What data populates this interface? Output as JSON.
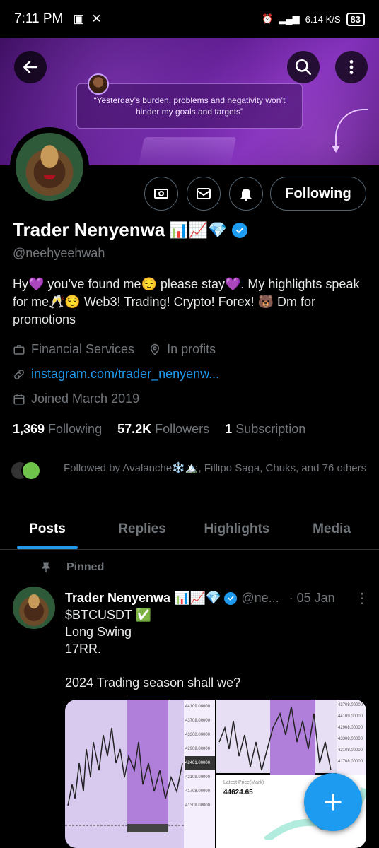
{
  "status_bar": {
    "time": "7:11 PM",
    "network_speed": "6.14",
    "network_speed_unit": "K/S",
    "battery": "83"
  },
  "banner": {
    "quote": "“Yesterday’s burden, problems and negativity won’t hinder my goals and targets”"
  },
  "profile": {
    "name": "Trader Nenyenwa",
    "name_emojis": "📊📈💎",
    "handle": "@neehyeehwah",
    "bio": "Hy💜 you’ve found me😌 please stay💜. My highlights speak for me🥂😌 Web3! Trading! Crypto! Forex! 🐻 Dm for promotions",
    "category": "Financial Services",
    "location": "In profits",
    "website": "instagram.com/trader_nenyenw...",
    "joined": "Joined March 2019",
    "follow_button": "Following",
    "following_count": "1,369",
    "following_label": "Following",
    "followers_count": "57.2K",
    "followers_label": "Followers",
    "subscription_count": "1",
    "subscription_label": "Subscription",
    "followed_by": "Followed by Avalanche❄️🏔️, Fillipo Saga, Chuks, and 76 others"
  },
  "tabs": [
    "Posts",
    "Replies",
    "Highlights",
    "Media"
  ],
  "active_tab": "Posts",
  "pinned_post": {
    "pinned_label": "Pinned",
    "author": "Trader Nenyenwa 📊📈💎",
    "handle": "@ne...",
    "date": "· 05 Jan",
    "body": "$BTCUSDT ✅\nLong Swing\n17RR.\n\n2024 Trading season shall we?",
    "chart_labels": {
      "price_1": "44109.00000",
      "price_2": "43708.00000",
      "price_3": "43308.00000",
      "price_4": "42908.00000",
      "price_5": "42461.00000",
      "price_6": "42108.00000",
      "price_7": "41708.00000",
      "price_8": "41308.00000",
      "latest_price_label": "Latest Price(Mark)",
      "latest_price": "44624.65"
    }
  },
  "colors": {
    "accent": "#1d9bf0",
    "background": "#000000",
    "secondary_text": "#71767b",
    "banner_purple": "#5a1a8a"
  },
  "icons": {
    "back": "arrow-left-icon",
    "search": "search-icon",
    "more": "more-vertical-icon",
    "subscribe": "money-icon",
    "message": "envelope-icon",
    "notify": "bell-icon",
    "verified": "verified-check-icon",
    "category": "briefcase-icon",
    "location": "location-pin-icon",
    "link": "link-icon",
    "joined": "calendar-icon",
    "pin": "pin-icon",
    "compose": "plus-icon"
  }
}
